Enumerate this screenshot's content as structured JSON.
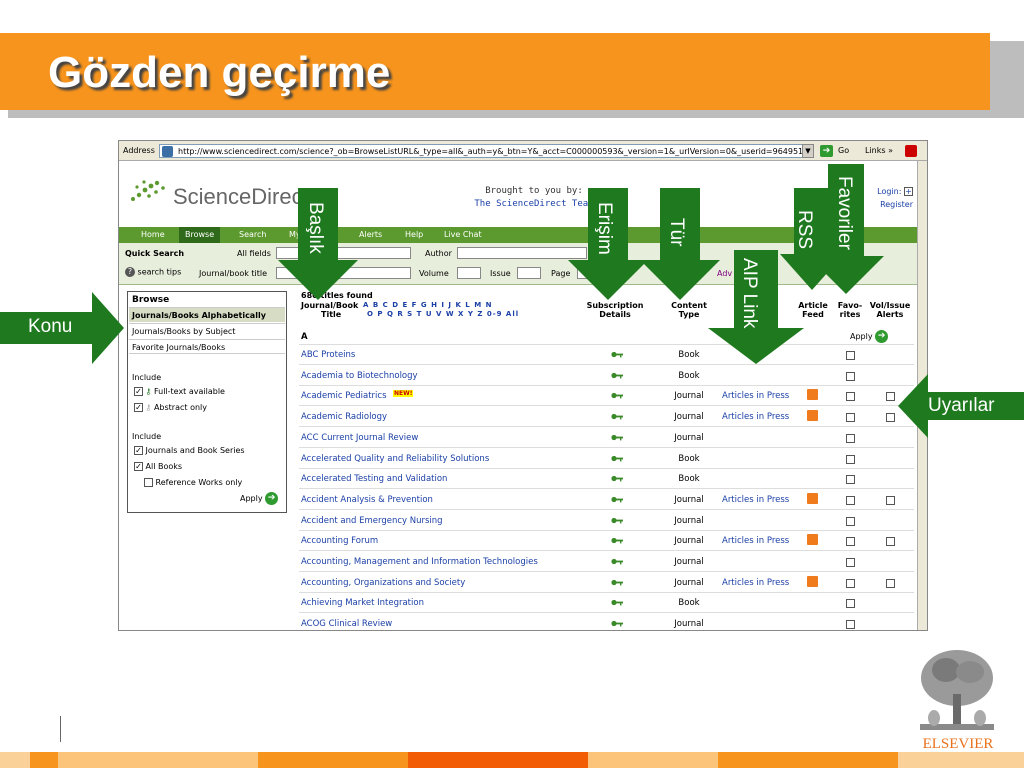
{
  "slide": {
    "title": "Gözden geçirme",
    "accent_color": "#f7941d",
    "arrow_color": "#1f7a1f"
  },
  "browser": {
    "address_label": "Address",
    "url": "http://www.sciencedirect.com/science?_ob=BrowseListURL&_type=all&_auth=y&_btn=Y&_acct=C000000593&_version=1&_urlVersion=0&_userid=964951&md5=",
    "go_label": "Go",
    "links_label": "Links"
  },
  "site": {
    "logo_text": "ScienceDirect",
    "brought_line1": "Brought to you by:",
    "brought_line2": "The ScienceDirect Team",
    "login": "Login:",
    "register": "Register",
    "nav": [
      "Home",
      "Browse",
      "Search",
      "My",
      "Alerts",
      "Help",
      "Live Chat"
    ],
    "quick_search": "Quick Search",
    "all_fields": "All fields",
    "author": "Author",
    "search_tips": "search tips",
    "journal_book_title": "Journal/book title",
    "volume": "Volume",
    "issue": "Issue",
    "page": "Page",
    "adv": "Adv"
  },
  "sidebar": {
    "heading": "Browse",
    "items": [
      "Journals/Books Alphabetically",
      "Journals/Books by Subject",
      "Favorite Journals/Books"
    ],
    "include1": "Include",
    "fulltext": "Full-text available",
    "abstract": "Abstract only",
    "include2": "Include",
    "journals_series": "Journals and Book Series",
    "all_books": "All Books",
    "ref_works": "Reference Works only",
    "apply": "Apply"
  },
  "table": {
    "count": "680 titles found",
    "col_title_1": "Journal/Book",
    "col_title_2": "Title",
    "letters_row1": "A B C D E F G H I J K L M N",
    "letters_row2": "O P Q R S T U V W X Y Z 0-9 All",
    "col_sub_1": "Subscription",
    "col_sub_2": "Details",
    "col_type_1": "Content",
    "col_type_2": "Type",
    "col_feed_1": "Article",
    "col_feed_2": "Feed",
    "col_fav_1": "Favo-",
    "col_fav_2": "rites",
    "col_alert_1": "Vol/Issue",
    "col_alert_2": "Alerts",
    "section_letter": "A",
    "apply": "Apply",
    "new_badge": "NEW!",
    "rows": [
      {
        "title": "ABC Proteins",
        "type": "Book",
        "aip": "",
        "rss": false,
        "alert": false,
        "new": false
      },
      {
        "title": "Academia to Biotechnology",
        "type": "Book",
        "aip": "",
        "rss": false,
        "alert": false,
        "new": false
      },
      {
        "title": "Academic Pediatrics",
        "type": "Journal",
        "aip": "Articles in Press",
        "rss": true,
        "alert": true,
        "new": true
      },
      {
        "title": "Academic Radiology",
        "type": "Journal",
        "aip": "Articles in Press",
        "rss": true,
        "alert": true,
        "new": false
      },
      {
        "title": "ACC Current Journal Review",
        "type": "Journal",
        "aip": "",
        "rss": false,
        "alert": false,
        "new": false
      },
      {
        "title": "Accelerated Quality and Reliability Solutions",
        "type": "Book",
        "aip": "",
        "rss": false,
        "alert": false,
        "new": false
      },
      {
        "title": "Accelerated Testing and Validation",
        "type": "Book",
        "aip": "",
        "rss": false,
        "alert": false,
        "new": false
      },
      {
        "title": "Accident Analysis & Prevention",
        "type": "Journal",
        "aip": "Articles in Press",
        "rss": true,
        "alert": true,
        "new": false
      },
      {
        "title": "Accident and Emergency Nursing",
        "type": "Journal",
        "aip": "",
        "rss": false,
        "alert": false,
        "new": false
      },
      {
        "title": "Accounting Forum",
        "type": "Journal",
        "aip": "Articles in Press",
        "rss": true,
        "alert": true,
        "new": false
      },
      {
        "title": "Accounting, Management and Information Technologies",
        "type": "Journal",
        "aip": "",
        "rss": false,
        "alert": false,
        "new": false
      },
      {
        "title": "Accounting, Organizations and Society",
        "type": "Journal",
        "aip": "Articles in Press",
        "rss": true,
        "alert": true,
        "new": false
      },
      {
        "title": "Achieving Market Integration",
        "type": "Book",
        "aip": "",
        "rss": false,
        "alert": false,
        "new": false
      },
      {
        "title": "ACOG Clinical Review",
        "type": "Journal",
        "aip": "",
        "rss": false,
        "alert": false,
        "new": false
      }
    ]
  },
  "callouts": {
    "konu": "Konu",
    "baslik": "Başlık",
    "erisim": "Erişim",
    "tur": "Tür",
    "aip": "AIP Link",
    "rss": "RSS",
    "favoriler": "Favoriler",
    "uyarilar": "Uyarılar"
  },
  "logo": {
    "publisher": "ELSEVIER"
  }
}
